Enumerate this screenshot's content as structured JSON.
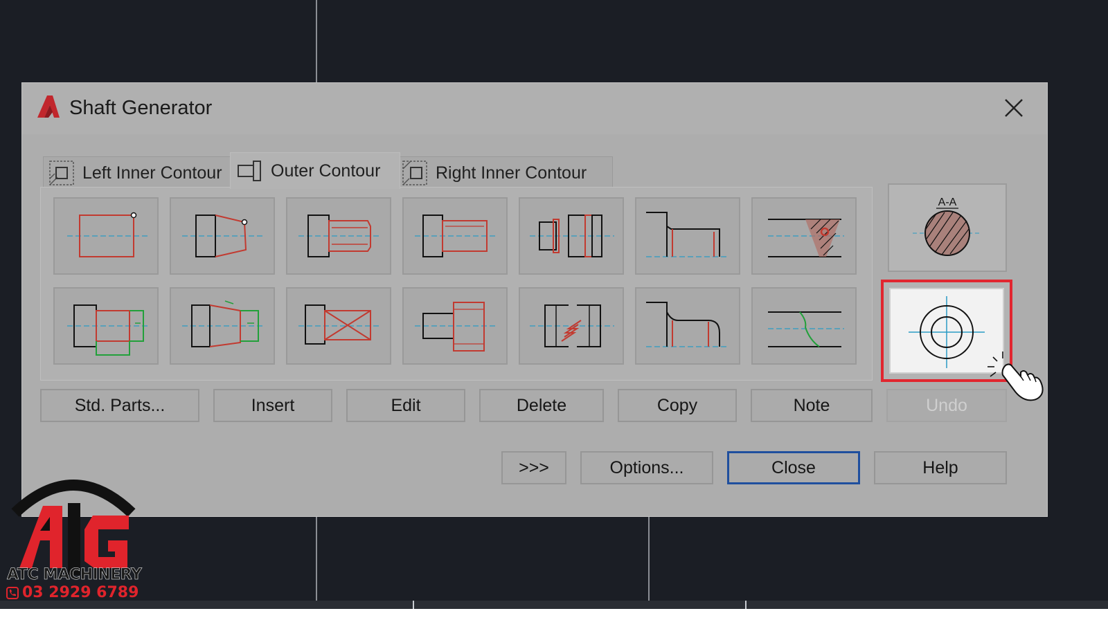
{
  "dialog": {
    "title": "Shaft Generator",
    "app_icon": "autocad-a-icon",
    "close_icon": "close-icon"
  },
  "tabs": [
    {
      "label": "Left Inner Contour",
      "icon": "left-inner-contour-icon",
      "active": false
    },
    {
      "label": "Outer Contour",
      "icon": "outer-contour-icon",
      "active": true
    },
    {
      "label": "Right Inner Contour",
      "icon": "right-inner-contour-icon",
      "active": false
    }
  ],
  "section_view": {
    "label": "A-A"
  },
  "buttons": {
    "std_parts": "Std. Parts...",
    "insert": "Insert",
    "edit": "Edit",
    "delete": "Delete",
    "copy": "Copy",
    "note": "Note",
    "undo": "Undo",
    "more": ">>>",
    "options": "Options...",
    "close": "Close",
    "help": "Help"
  },
  "branding": {
    "name": "ATC MACHINERY",
    "phone": "03 2929 6789"
  },
  "colors": {
    "accent_red": "#e1262f",
    "focus_blue": "#1f4f9e"
  }
}
